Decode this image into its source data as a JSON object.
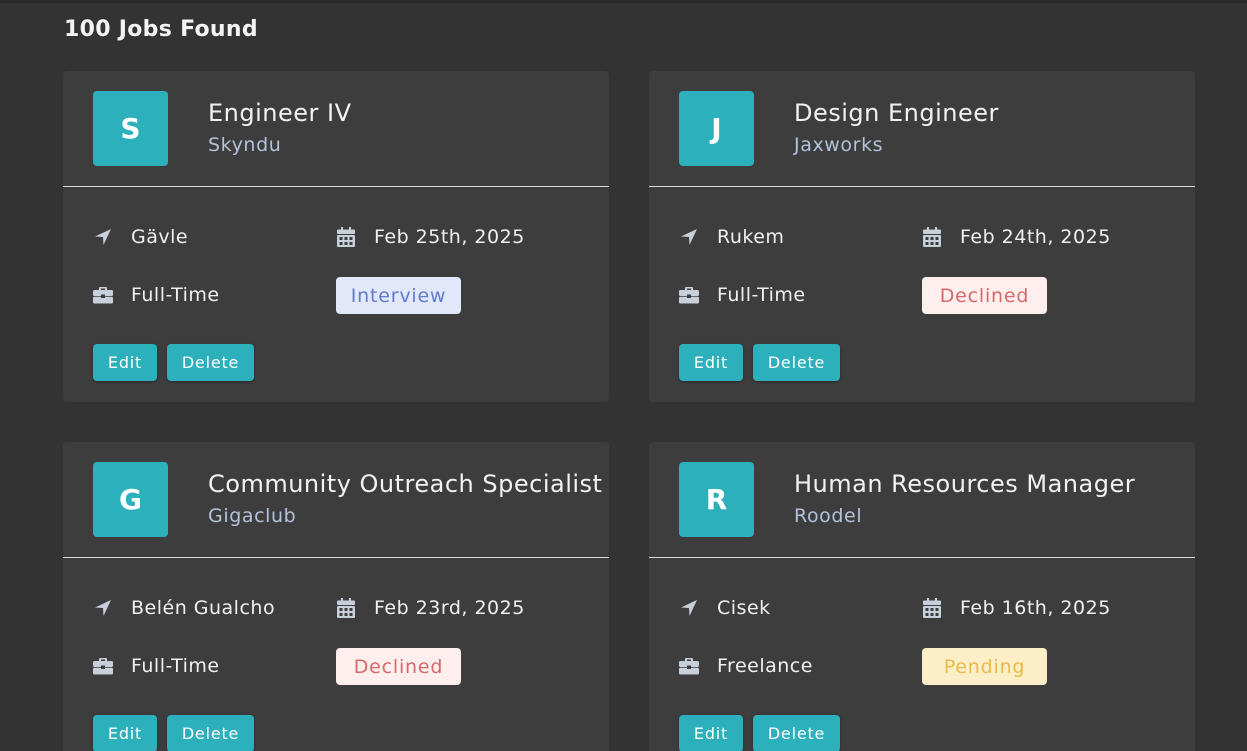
{
  "header": {
    "title": "100 Jobs Found"
  },
  "colors": {
    "accent": "#2cb1bc",
    "background": "#333333",
    "card": "#3d3d3d",
    "interview_bg": "#e0e8f9",
    "interview_text": "#647acb",
    "declined_bg": "#ffeeee",
    "declined_text": "#d66a6a",
    "pending_bg": "#fcefc7",
    "pending_text": "#e9b949"
  },
  "icons": {
    "location": "location-arrow-icon",
    "date": "calendar-icon",
    "type": "briefcase-icon"
  },
  "jobs": [
    {
      "initial": "S",
      "position": "Engineer IV",
      "company": "Skyndu",
      "location": "Gävle",
      "date": "Feb 25th, 2025",
      "type": "Full-Time",
      "status": "Interview",
      "status_kind": "interview",
      "edit_label": "Edit",
      "delete_label": "Delete"
    },
    {
      "initial": "J",
      "position": "Design Engineer",
      "company": "Jaxworks",
      "location": "Rukem",
      "date": "Feb 24th, 2025",
      "type": "Full-Time",
      "status": "Declined",
      "status_kind": "declined",
      "edit_label": "Edit",
      "delete_label": "Delete"
    },
    {
      "initial": "G",
      "position": "Community Outreach Specialist",
      "company": "Gigaclub",
      "location": "Belén Gualcho",
      "date": "Feb 23rd, 2025",
      "type": "Full-Time",
      "status": "Declined",
      "status_kind": "declined",
      "edit_label": "Edit",
      "delete_label": "Delete"
    },
    {
      "initial": "R",
      "position": "Human Resources Manager",
      "company": "Roodel",
      "location": "Cisek",
      "date": "Feb 16th, 2025",
      "type": "Freelance",
      "status": "Pending",
      "status_kind": "pending",
      "edit_label": "Edit",
      "delete_label": "Delete"
    }
  ]
}
